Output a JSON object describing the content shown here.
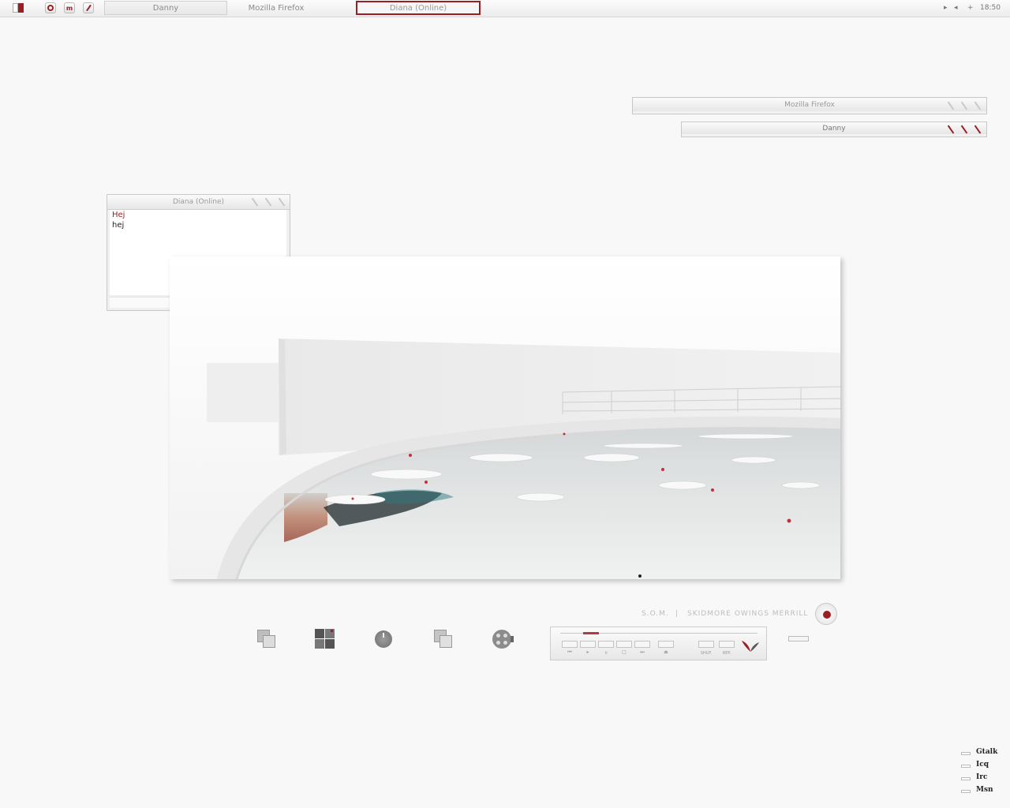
{
  "taskbar": {
    "menu_icon": "menu-icon",
    "launchers": [
      {
        "name": "firefox-launcher-icon"
      },
      {
        "name": "gmail-launcher-icon",
        "glyph": "m"
      },
      {
        "name": "pidgin-launcher-icon"
      }
    ],
    "tasks": [
      {
        "label": "Danny",
        "state": "normal"
      },
      {
        "label": "Mozilla Firefox",
        "state": "flat"
      },
      {
        "label": "Diana (Online)",
        "state": "active"
      }
    ],
    "tray": {
      "glyphs": [
        "▸",
        "◂",
        "+"
      ],
      "clock": "18:50"
    }
  },
  "windows": {
    "firefox_title": "Mozilla Firefox",
    "danny_title": "Danny"
  },
  "chat": {
    "title": "Diana (Online)",
    "messages": [
      {
        "text": "Hej",
        "from": "remote"
      },
      {
        "text": "hej",
        "from": "local"
      }
    ]
  },
  "caption": {
    "short": "S.O.M.",
    "separator": "|",
    "full": "SKIDMORE OWINGS MERRILL"
  },
  "dock": [
    {
      "name": "windows-dock-icon"
    },
    {
      "name": "workspace-grid-dock-icon"
    },
    {
      "name": "disc-dock-icon"
    },
    {
      "name": "windows-alt-dock-icon"
    },
    {
      "name": "film-reel-dock-icon"
    }
  ],
  "player": {
    "progress": 0.14,
    "buttons": [
      "previous",
      "play",
      "pause",
      "stop",
      "next",
      "eject",
      "shuffle",
      "repeat"
    ],
    "shuffle_label": "SHUF.",
    "repeat_label": "REP."
  },
  "protocols": [
    "Gtalk",
    "Icq",
    "Irc",
    "Msn"
  ],
  "colors": {
    "accent": "#9b1e24",
    "background": "#f8f8f8"
  }
}
